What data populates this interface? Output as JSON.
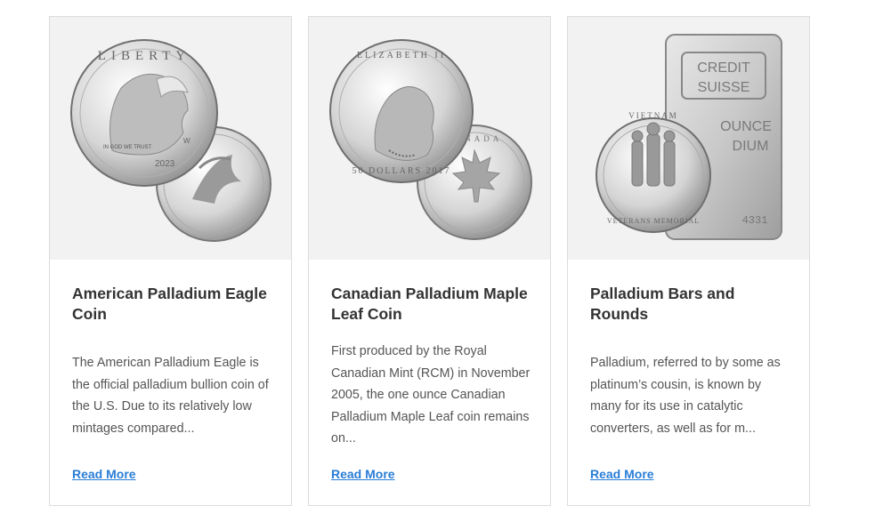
{
  "cards": [
    {
      "title": "American Palladium Eagle Coin",
      "description": "The American Palladium Eagle is the official palladium bullion coin of the U.S. Due to its relatively low mintages compared...",
      "link": "Read More",
      "image_text": {
        "front_top": "LIBERTY",
        "motto": "IN GOD WE TRUST",
        "year": "2023",
        "mint": "W"
      }
    },
    {
      "title": "Canadian Palladium Maple Leaf Coin",
      "description": "First produced by the Royal Canadian Mint (RCM) in November 2005, the one ounce Canadian Palladium Maple Leaf coin remains on...",
      "link": "Read More",
      "image_text": {
        "front_top": "ELIZABETH II",
        "front_bottom": "50 DOLLARS 2017",
        "back": "CANADA"
      }
    },
    {
      "title": "Palladium Bars and Rounds",
      "description": "Palladium, referred to by some as platinum’s cousin, is known by many for its use in catalytic converters, as well as for m...",
      "link": "Read More",
      "image_text": {
        "bar_brand": "CREDIT SUISSE",
        "bar_weight": "OUNCE",
        "bar_metal": "DIUM",
        "round_top": "VIETNAM",
        "round_bottom": "VETERANS MEMORIAL"
      }
    }
  ]
}
